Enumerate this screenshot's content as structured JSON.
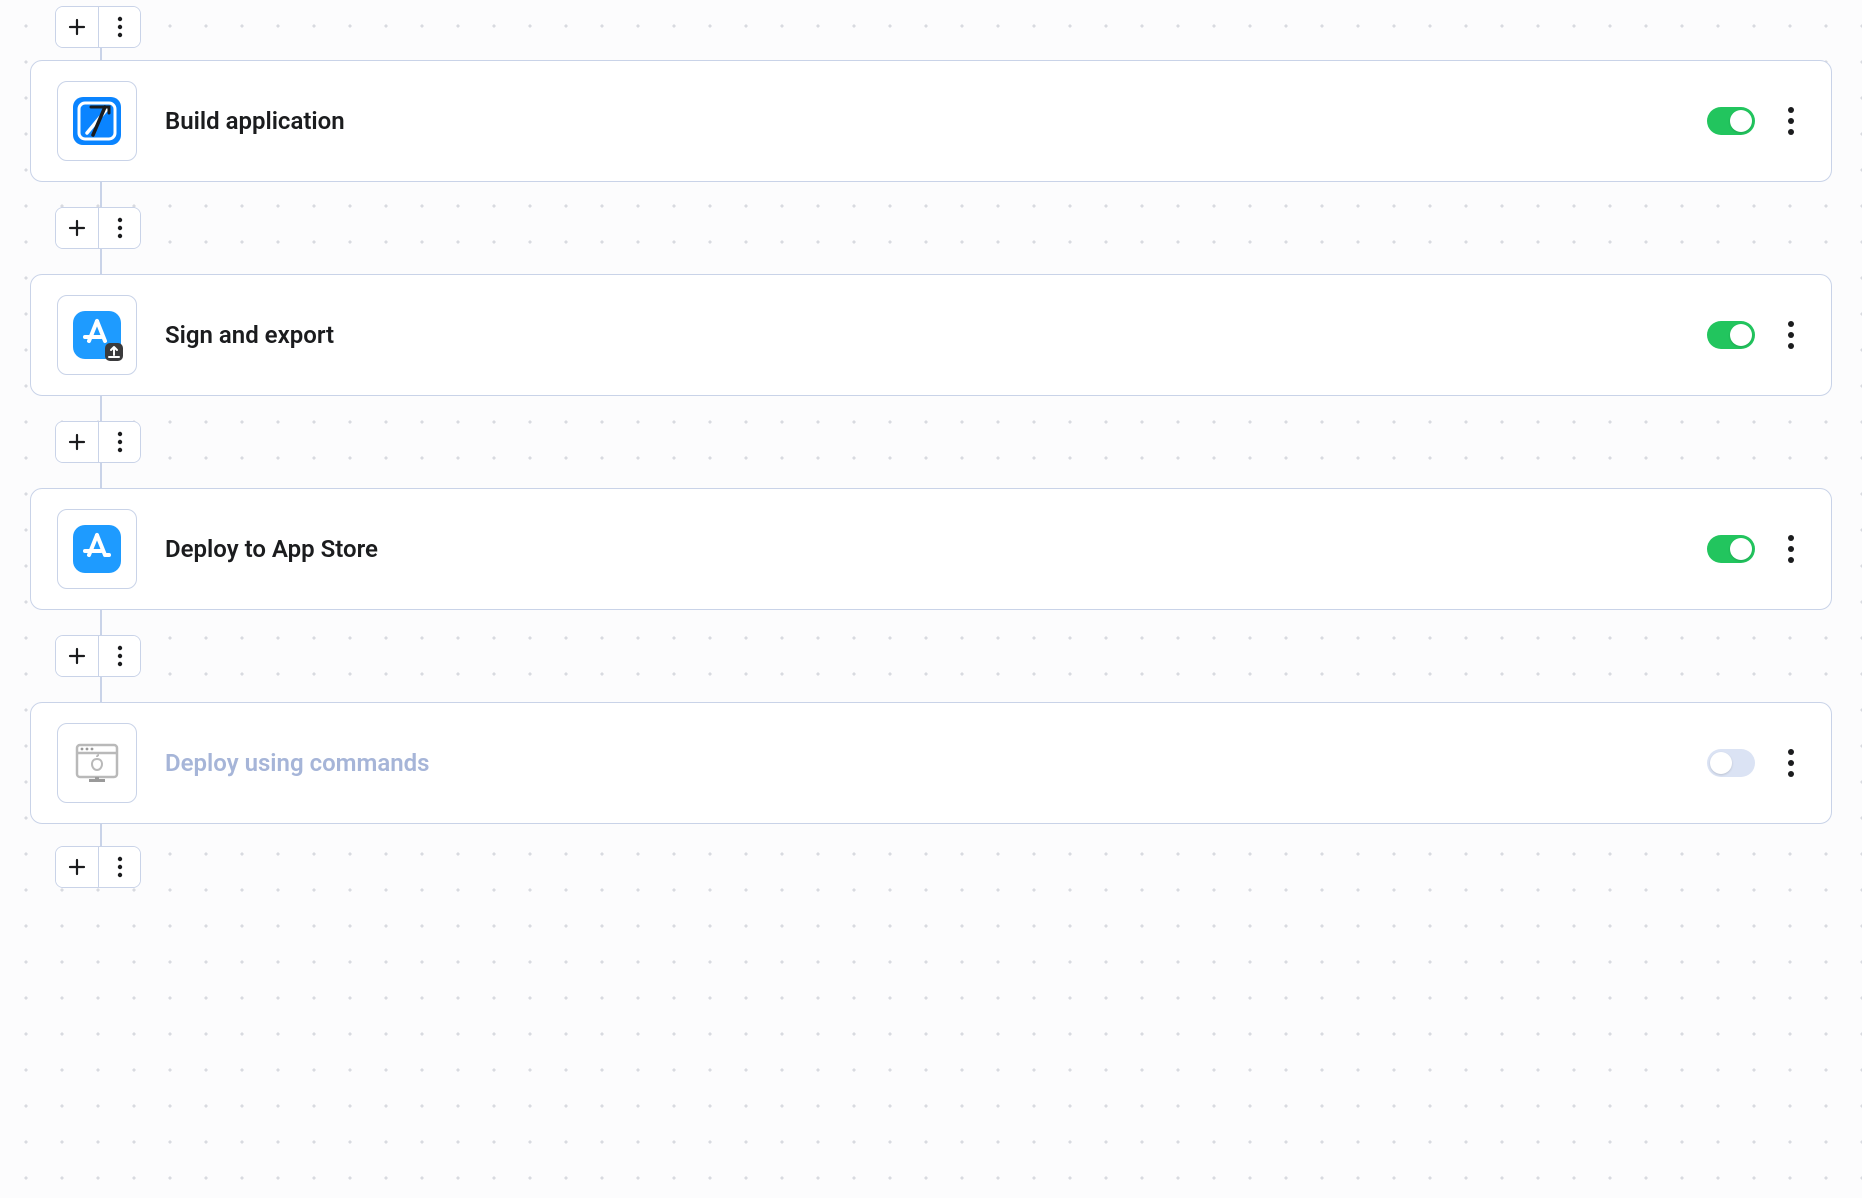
{
  "steps": [
    {
      "id": "build",
      "title": "Build application",
      "icon": "xcode-hammer",
      "enabled": true
    },
    {
      "id": "sign",
      "title": "Sign and export",
      "icon": "appstore-export",
      "enabled": true
    },
    {
      "id": "deploy",
      "title": "Deploy to App Store",
      "icon": "appstore",
      "enabled": true
    },
    {
      "id": "cmd",
      "title": "Deploy using commands",
      "icon": "terminal-apple",
      "enabled": false
    }
  ],
  "colors": {
    "accent_green": "#22c55e",
    "border": "#c9d3e8",
    "disabled_text": "#a6b5d8"
  }
}
